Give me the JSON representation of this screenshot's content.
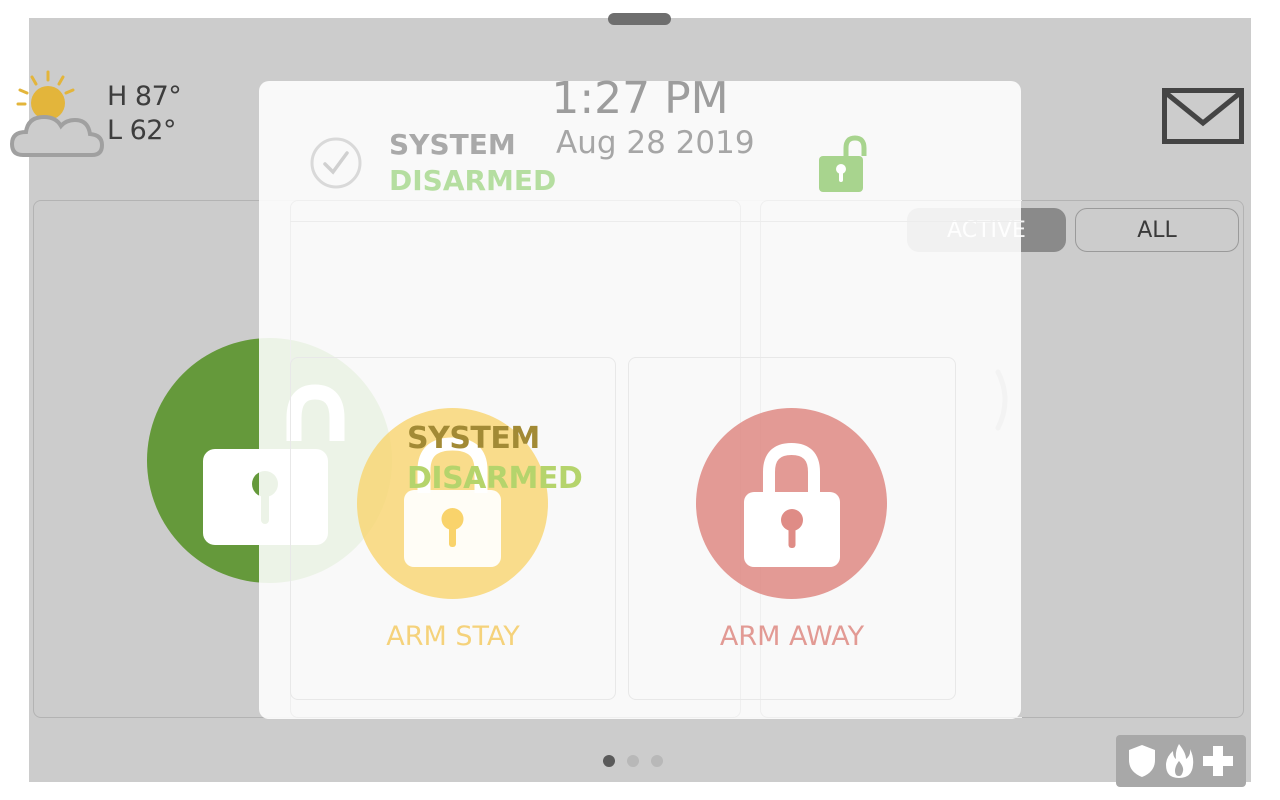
{
  "weather": {
    "high": "H 87°",
    "low": "L 62°",
    "icon": "partly-cloudy-icon"
  },
  "header": {
    "time": "1:27 PM",
    "date": "Aug 28 2019"
  },
  "status": {
    "line1": "SYSTEM",
    "line2": "DISARMED"
  },
  "filters": {
    "active_label": "ACTIVE",
    "all_label": "ALL"
  },
  "arm": {
    "stay_label": "ARM STAY",
    "away_label": "ARM AWAY"
  },
  "pager": {
    "pages": 3,
    "current": 1
  },
  "colors": {
    "disarmed_green": "#65993b",
    "stay_yellow": "#f9d36b",
    "away_red": "#df8c86",
    "background": "#cccccc"
  },
  "icons": [
    "partly-cloudy-icon",
    "mail-icon",
    "unlock-icon",
    "lock-icon",
    "check-icon",
    "chevron-right-icon",
    "shield-icon",
    "fire-icon",
    "medical-cross-icon"
  ]
}
